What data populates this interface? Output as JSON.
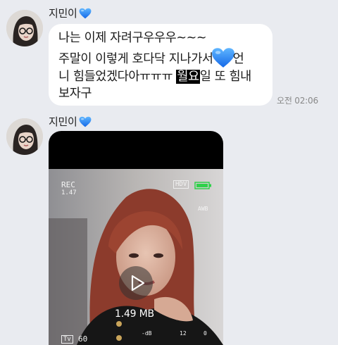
{
  "messages": [
    {
      "sender": "지민이",
      "lines": [
        "나는 이제 자려구우우우~~~",
        "주말이 이렇게 호다닥 지나가서",
        "언",
        "니 힘들었겠다아ㅠㅠㅠ ",
        "월요",
        "일 또 힘내",
        "보자구"
      ],
      "time": "오전 02:06"
    },
    {
      "sender": "지민이",
      "video": {
        "file_size": "1.49 MB",
        "overlay": {
          "rec": "REC",
          "rec_time": "1.47",
          "hdv": "HDV",
          "awb": "AWB",
          "tv": "Tv",
          "tv_value": "60",
          "db": "-dB",
          "db_value": "12",
          "zero": "0"
        }
      }
    }
  ],
  "colors": {
    "background": "#e9ebf0",
    "bubble": "#ffffff",
    "heart": "#1e8fff",
    "highlight_bg": "#000000"
  },
  "icons": [
    "blue-heart-icon",
    "play-icon",
    "battery-icon"
  ]
}
